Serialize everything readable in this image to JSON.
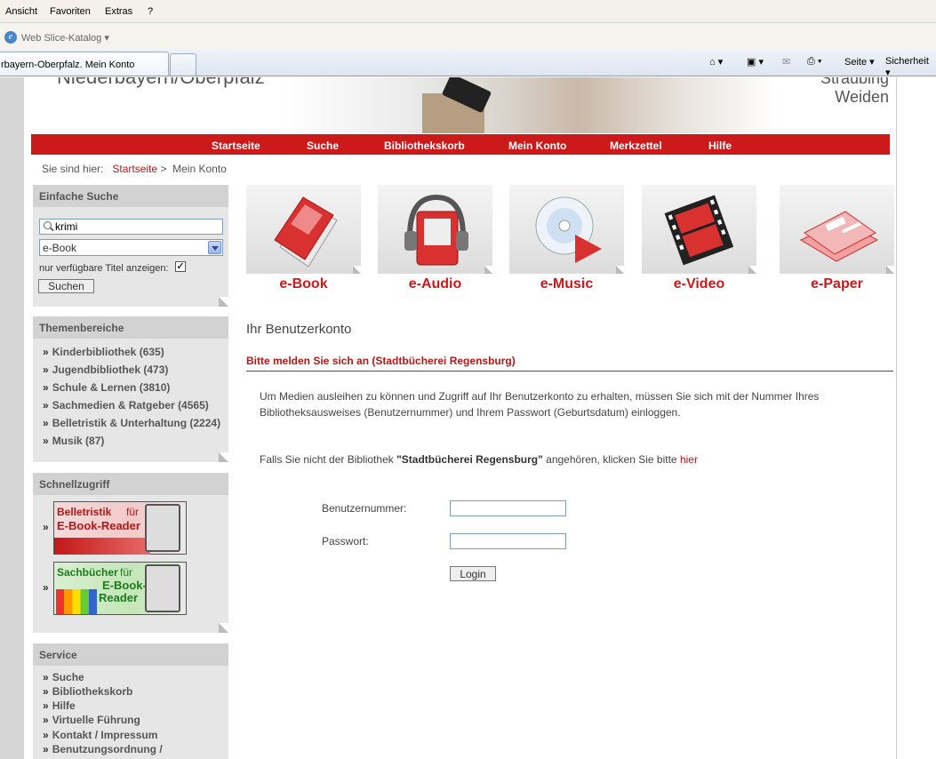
{
  "browser": {
    "menu": [
      "Ansicht",
      "Favoriten",
      "Extras",
      "?"
    ],
    "web_slice": "Web Slice-Katalog",
    "tab_title": "rbayern-Oberpfalz. Mein Konto",
    "toolbar": {
      "page": "Seite",
      "security": "Sicherheit"
    }
  },
  "header": {
    "region": "Niederbayern/Oberpfalz",
    "city1": "Straubing",
    "city2": "Weiden"
  },
  "nav": [
    "Startseite",
    "Suche",
    "Bibliothekskorb",
    "Mein Konto",
    "Merkzettel",
    "Hilfe"
  ],
  "breadcrumb": {
    "prefix": "Sie sind hier:",
    "home": "Startseite",
    "sep": ">",
    "current": "Mein Konto"
  },
  "simple_search": {
    "title": "Einfache Suche",
    "query": "krimi",
    "media_type": "e-Book",
    "available_label": "nur verfügbare Titel anzeigen:",
    "available_checked": true,
    "button": "Suchen"
  },
  "topics": {
    "title": "Themenbereiche",
    "items": [
      "Kinderbibliothek (635)",
      "Jugendbibliothek (473)",
      "Schule & Lernen (3810)",
      "Sachmedien & Ratgeber (4565)",
      "Belletristik & Unterhaltung (2224)",
      "Musik (87)"
    ]
  },
  "quick_access": {
    "title": "Schnellzugriff",
    "promo1": {
      "line1": "Belletristik",
      "line1b": "für",
      "line2": "E-Book-Reader"
    },
    "promo2": {
      "line1": "Sachbücher",
      "line1b": "für",
      "line2": "E-Book-",
      "line3": "Reader"
    }
  },
  "service": {
    "title": "Service",
    "items": [
      "Suche",
      "Bibliothekskorb",
      "Hilfe",
      "Virtuelle Führung",
      "Kontakt / Impressum",
      "Benutzungsordnung /"
    ]
  },
  "media": [
    {
      "label": "e-Book",
      "icon": "book-icon"
    },
    {
      "label": "e-Audio",
      "icon": "headphones-icon"
    },
    {
      "label": "e-Music",
      "icon": "cd-icon"
    },
    {
      "label": "e-Video",
      "icon": "film-icon"
    },
    {
      "label": "e-Paper",
      "icon": "newspaper-icon"
    }
  ],
  "account": {
    "title": "Ihr Benutzerkonto",
    "login_hint": "Bitte melden Sie sich an (Stadtbücherei Regensburg)",
    "intro": "Um Medien ausleihen zu können und Zugriff auf Ihr Benutzerkonto zu erhalten, müssen Sie sich mit der Nummer Ihres Bibliotheksausweises (Benutzernummer) und Ihrem Passwort (Geburtsdatum) einloggen.",
    "other_prefix": "Falls Sie nicht der Bibliothek ",
    "other_lib": "\"Stadtbücherei Regensburg\"",
    "other_mid": " angehören, klicken Sie bitte ",
    "other_link": "hier",
    "user_label": "Benutzernummer:",
    "pass_label": "Passwort:",
    "user_value": "",
    "pass_value": "",
    "login_button": "Login"
  },
  "colors": {
    "accent": "#cc1a1a",
    "link": "#b31818",
    "sidebar": "#e6e6e6"
  }
}
